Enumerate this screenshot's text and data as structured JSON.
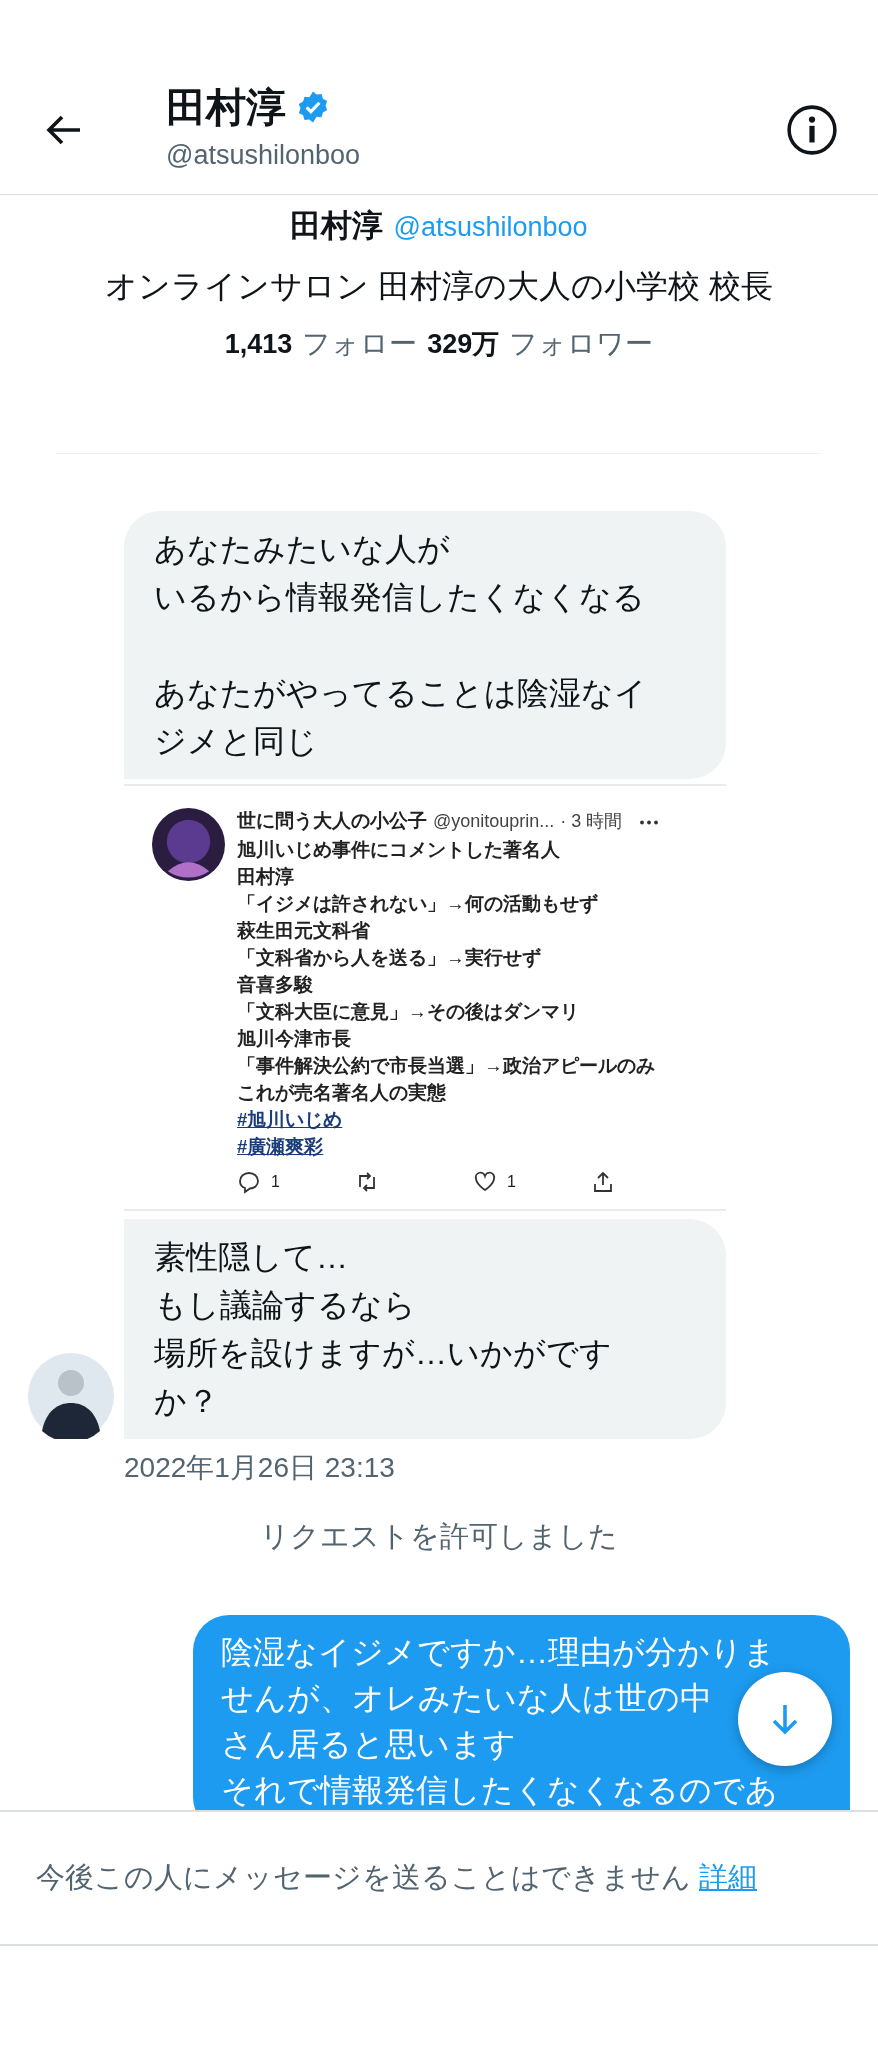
{
  "header": {
    "name": "田村淳",
    "handle": "@atsushilonboo",
    "verified": true
  },
  "profile": {
    "name": "田村淳",
    "handle": "@atsushilonboo",
    "bio": "オンラインサロン 田村淳の大人の小学校 校長",
    "following_count": "1,413",
    "following_label": "フォロー",
    "followers_count": "329万",
    "followers_label": "フォロワー"
  },
  "messages": [
    {
      "kind": "received",
      "avatar": false,
      "paragraphs": [
        [
          "あなたみたいな人が",
          "いるから情報発信したくなくなる"
        ],
        [
          "あなたがやってることは陰湿なイ",
          "ジメと同じ"
        ]
      ]
    },
    {
      "kind": "tweet",
      "name": "世に問う大人の小公子",
      "handle": "@yonitouprin...",
      "time": "· 3 時間",
      "lines": [
        "旭川いじめ事件にコメントした著名人",
        "田村淳",
        "「イジメは許されない」→何の活動もせず",
        "萩生田元文科省",
        "「文科省から人を送る」→実行せず",
        "音喜多駿",
        "「文科大臣に意見」→その後はダンマリ",
        "旭川今津市長",
        "「事件解決公約で市長当選」→政治アピールのみ",
        "これが売名著名人の実態"
      ],
      "hashtags": [
        "#旭川いじめ",
        "#廣瀬爽彩"
      ],
      "reply_count": "1",
      "like_count": "1"
    },
    {
      "kind": "received",
      "avatar": true,
      "paragraphs": [
        [
          "素性隠して…",
          "もし議論するなら",
          "場所を設けますが…いかがです",
          "か？"
        ]
      ]
    },
    {
      "kind": "timestamp",
      "text": "2022年1月26日 23:13"
    },
    {
      "kind": "notice",
      "text": "リクエストを許可しました"
    },
    {
      "kind": "sent",
      "paragraphs": [
        [
          "陰湿なイジメですか…理由が分かりま",
          "せんが、オレみたいな人は世の中",
          "さん居ると思います",
          "それで情報発信したくなくなるのであ"
        ]
      ]
    }
  ],
  "footer": {
    "text": "今後この人にメッセージを送ることはできません",
    "link": "詳細"
  }
}
